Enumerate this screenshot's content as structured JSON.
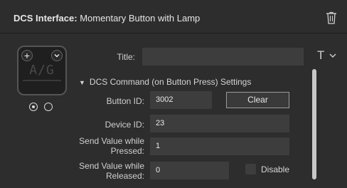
{
  "header": {
    "title_bold": "DCS Interface:",
    "title_rest": " Momentary Button with Lamp"
  },
  "preview": {
    "text": "A/G",
    "state_count": 2,
    "selected_state": 0
  },
  "title_field": {
    "label": "Title:",
    "value": ""
  },
  "section": {
    "label": "DCS Command (on Button Press) Settings",
    "expanded": true
  },
  "fields": {
    "button_id": {
      "label": "Button ID:",
      "value": "3002"
    },
    "clear_label": "Clear",
    "device_id": {
      "label": "Device ID:",
      "value": "23"
    },
    "send_pressed": {
      "label_line1": "Send Value while",
      "label_line2": "Pressed:",
      "value": "1"
    },
    "send_released": {
      "label_line1": "Send Value while",
      "label_line2": "Released:",
      "value": "0"
    },
    "disable": {
      "label": "Disable",
      "checked": false
    }
  },
  "icons": {
    "trash": "trash-icon",
    "plus": "plus-icon",
    "chevron": "chevron-down-icon",
    "font": "font-icon"
  },
  "colors": {
    "background": "#2d2d2d",
    "field": "#3d3d3d",
    "text": "#d6d6d6",
    "button_border": "#9a9a9a"
  }
}
